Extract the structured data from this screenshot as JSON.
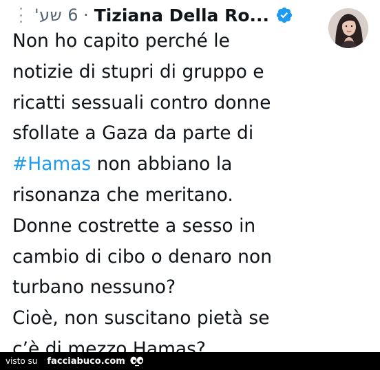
{
  "tweet": {
    "time": "6 שע'",
    "separator": "·",
    "author": "Tiziana Della Ro...",
    "text_lines": [
      "Non ho capito perché le",
      "notizie di stupri di gruppo e",
      "ricatti sessuali contro donne",
      "sfollate a Gaza da parte di",
      "non abbiano la",
      "risonanza che meritano.",
      "Donne costrette a sesso in",
      "cambio di cibo o denaro non",
      "turbano nessuno?",
      "Cioè, non suscitano pietà se",
      "c’è di mezzo Hamas?"
    ],
    "hashtag": "#Hamas",
    "icons": {
      "more": "more-dots-icon",
      "verified": "verified-badge-icon",
      "avatar": "profile-avatar"
    },
    "colors": {
      "text": "#0f1419",
      "muted": "#536471",
      "link": "#1d9bf0",
      "verified": "#1d9bf0"
    }
  },
  "footer": {
    "prefix": "visto su",
    "site": "facciabuco.com",
    "logo": "facciabuco-eyes-icon",
    "background": "#000000"
  }
}
